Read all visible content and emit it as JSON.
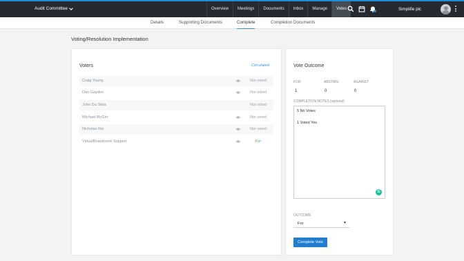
{
  "nav": {
    "committee": "Audit Committee",
    "items": [
      "Overview",
      "Meetings",
      "Documents",
      "Inbox",
      "Manage",
      "Votes"
    ],
    "active_item": "Votes",
    "org": "Simplifie plc"
  },
  "tabs": [
    "Details",
    "Supporting Documents",
    "Complete",
    "Completion Documents"
  ],
  "active_tab": "Complete",
  "page_title": "Voting/Resolution Implementation",
  "voters": {
    "title": "Voters",
    "status": "Circulated",
    "rows": [
      {
        "name": "Craig Young",
        "eye": true,
        "status": "Not voted"
      },
      {
        "name": "Dan Gaydon",
        "eye": true,
        "status": "Not voted"
      },
      {
        "name": "John Da Silva",
        "eye": false,
        "status": "Not voted"
      },
      {
        "name": "Michael McGirr",
        "eye": true,
        "status": "Not voted"
      },
      {
        "name": "Nicholas Roi",
        "eye": true,
        "status": "Not voted"
      },
      {
        "name": "VirtualBoardroom Support",
        "eye": true,
        "status": "For"
      }
    ]
  },
  "outcome": {
    "title": "Vote Outcome",
    "for_label": "FOR",
    "abstain_label": "ABSTAIN",
    "against_label": "AGAINST",
    "for_value": "1",
    "abstain_value": "0",
    "against_value": "0",
    "notes_label": "COMPLETION NOTES (optional)",
    "notes_lines": [
      "5 No Votes",
      "1 Voted Yes"
    ],
    "outcome_label": "OUTCOME",
    "outcome_value": "For",
    "button": "Complete Vote"
  },
  "colors": {
    "nav_bg": "#262a30",
    "accent": "#1f7ed0",
    "for_green": "#4caf50"
  }
}
